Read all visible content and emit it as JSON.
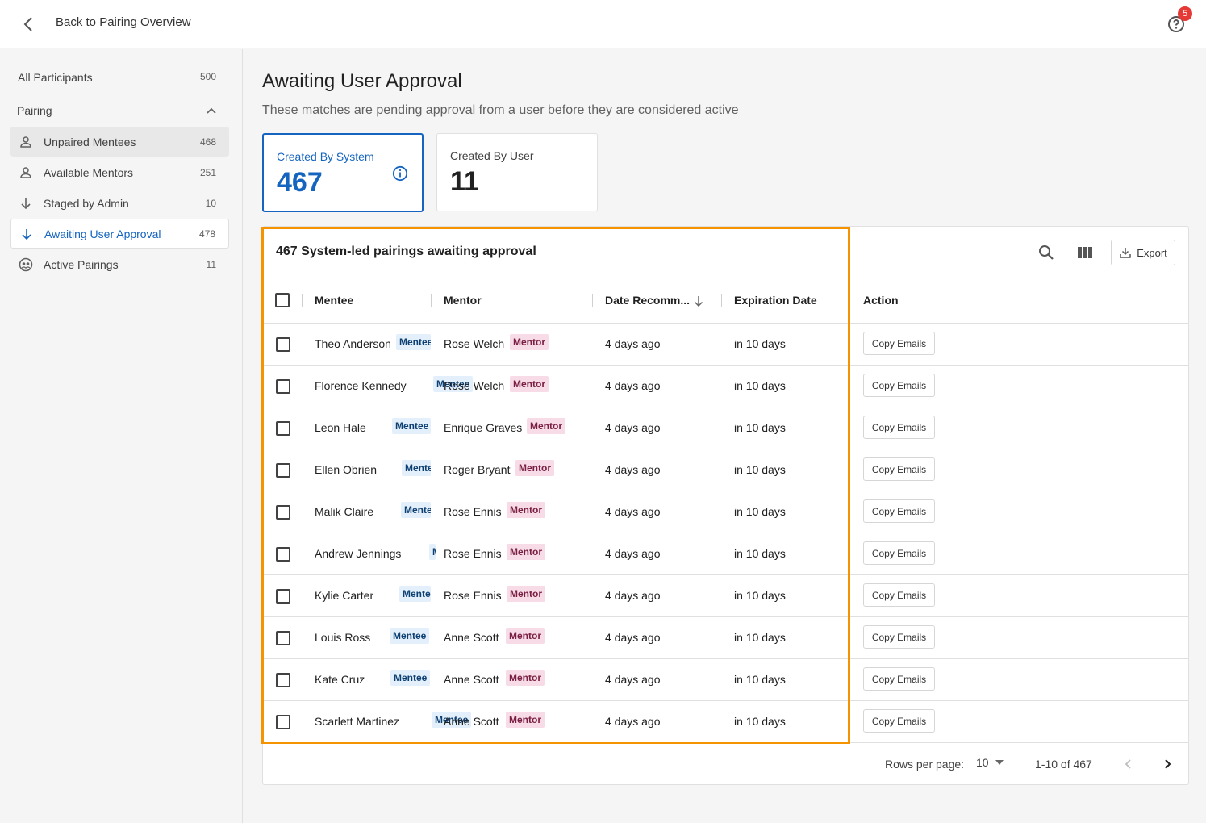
{
  "topbar": {
    "back_label": "Back to Pairing Overview",
    "help_badge": "5"
  },
  "sidebar": {
    "all": {
      "label": "All Participants",
      "count": "500"
    },
    "group": {
      "label": "Pairing"
    },
    "items": [
      {
        "label": "Unpaired Mentees",
        "count": "468",
        "icon": "person-icon"
      },
      {
        "label": "Available Mentors",
        "count": "251",
        "icon": "person-icon"
      },
      {
        "label": "Staged by Admin",
        "count": "10",
        "icon": "arrow-down-icon"
      },
      {
        "label": "Awaiting User Approval",
        "count": "478",
        "icon": "arrow-down-icon"
      },
      {
        "label": "Active Pairings",
        "count": "11",
        "icon": "pairing-icon"
      }
    ]
  },
  "main": {
    "title": "Awaiting User Approval",
    "subtitle": "These matches are pending approval from a user before they are considered active",
    "cards": [
      {
        "label": "Created By System",
        "value": "467"
      },
      {
        "label": "Created By User",
        "value": "11"
      }
    ]
  },
  "table": {
    "title": "467 System-led pairings awaiting approval",
    "export_label": "Export",
    "columns": {
      "mentee": "Mentee",
      "mentor": "Mentor",
      "date": "Date Recomm...",
      "expiration": "Expiration Date",
      "action": "Action"
    },
    "mentee_tag": "Mentee",
    "mentor_tag": "Mentor",
    "copy_label": "Copy Emails",
    "rows": [
      {
        "mentee": "Theo Anderson",
        "mentee_tag": "Mentee",
        "mentor": "Rose Welch",
        "mentor_tag": "Mentor",
        "date": "4 days ago",
        "expiration": "in 10 days"
      },
      {
        "mentee": "Florence Kennedy",
        "mentee_tag": "Mentee",
        "mentor": "Rose Welch",
        "mentor_tag": "Mentor",
        "date": "4 days ago",
        "expiration": "in 10 days"
      },
      {
        "mentee": "Leon Hale",
        "mentee_tag": "Mentee",
        "mentor": "Enrique Graves",
        "mentor_tag": "Mentor",
        "date": "4 days ago",
        "expiration": "in 10 days"
      },
      {
        "mentee": "Ellen Obrien",
        "mentee_tag": "Mentee",
        "mentor": "Roger Bryant",
        "mentor_tag": "Mentor",
        "date": "4 days ago",
        "expiration": "in 10 days"
      },
      {
        "mentee": "Malik Claire",
        "mentee_tag": "Mentee",
        "mentor": "Rose Ennis",
        "mentor_tag": "Mentor",
        "date": "4 days ago",
        "expiration": "in 10 days"
      },
      {
        "mentee": "Andrew Jennings",
        "mentee_tag": "Mentee",
        "mentor": "Rose Ennis",
        "mentor_tag": "Mentor",
        "date": "4 days ago",
        "expiration": "in 10 days"
      },
      {
        "mentee": "Kylie Carter",
        "mentee_tag": "Mentee",
        "mentor": "Rose Ennis",
        "mentor_tag": "Mentor",
        "date": "4 days ago",
        "expiration": "in 10 days"
      },
      {
        "mentee": "Louis Ross",
        "mentee_tag": "Mentee",
        "mentor": "Anne Scott",
        "mentor_tag": "Mentor",
        "date": "4 days ago",
        "expiration": "in 10 days"
      },
      {
        "mentee": "Kate Cruz",
        "mentee_tag": "Mentee",
        "mentor": "Anne Scott",
        "mentor_tag": "Mentor",
        "date": "4 days ago",
        "expiration": "in 10 days"
      },
      {
        "mentee": "Scarlett Martinez",
        "mentee_tag": "Mentee",
        "mentor": "Anne Scott",
        "mentor_tag": "Mentor",
        "date": "4 days ago",
        "expiration": "in 10 days"
      }
    ],
    "footer": {
      "rows_per_page_label": "Rows per page:",
      "rows_per_page": "10",
      "range": "1-10 of 467"
    }
  },
  "colors": {
    "accent": "#1565c0",
    "highlight": "#f59300",
    "mentee_tag_bg": "#e3f0fb",
    "mentor_tag_bg": "#f7dbe6"
  }
}
